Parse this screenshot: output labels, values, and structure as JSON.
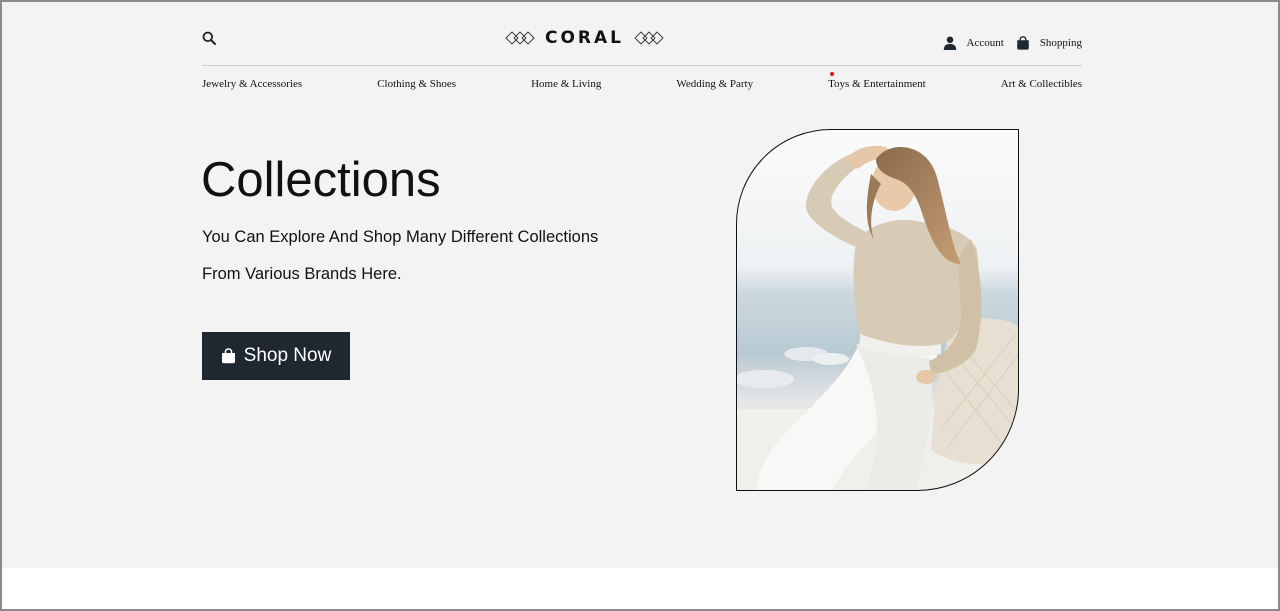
{
  "header": {
    "brand": "CORAL",
    "account_label": "Account",
    "shopping_label": "Shopping",
    "icons": [
      "search-icon",
      "user-icon",
      "shopping-bag-icon"
    ]
  },
  "nav": {
    "items": [
      {
        "label": "Jewelry & Accessories"
      },
      {
        "label": "Clothing & Shoes"
      },
      {
        "label": "Home & Living"
      },
      {
        "label": "Wedding & Party"
      },
      {
        "label": "Toys & Entertainment",
        "has_dot": true
      },
      {
        "label": "Art & Collectibles"
      }
    ]
  },
  "hero": {
    "title": "Collections",
    "line1": "You Can Explore And Shop Many Different Collections",
    "line2": "From Various Brands Here.",
    "cta_label": "Shop Now"
  },
  "colors": {
    "hero_background": "#f3f3f3",
    "button_background": "#1f2731",
    "nav_dot": "#ee1111"
  }
}
